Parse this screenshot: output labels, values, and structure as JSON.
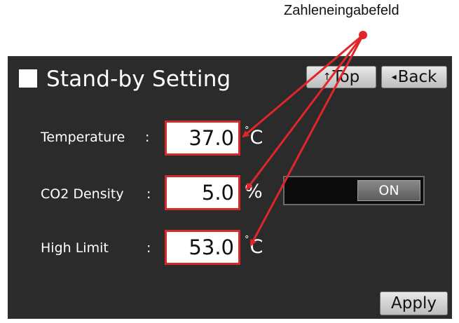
{
  "callout": {
    "label": "Zahleneingabefeld",
    "color": "#e0262a"
  },
  "screen": {
    "title": "Stand-by Setting",
    "nav": {
      "top_label": "Top",
      "top_icon": "up-arrow-icon",
      "back_label": "Back",
      "back_icon": "left-triangle-icon"
    },
    "fields": [
      {
        "label": "Temperature",
        "colon": ":",
        "value": "37.0",
        "unit": "C",
        "unit_prefix": "°"
      },
      {
        "label": "CO2 Density",
        "colon": ":",
        "value": "5.0",
        "unit": "%",
        "unit_prefix": ""
      },
      {
        "label": "High Limit",
        "colon": ":",
        "value": "53.0",
        "unit": "C",
        "unit_prefix": "°"
      }
    ],
    "co2_toggle": {
      "state": "ON"
    },
    "apply_label": "Apply"
  }
}
